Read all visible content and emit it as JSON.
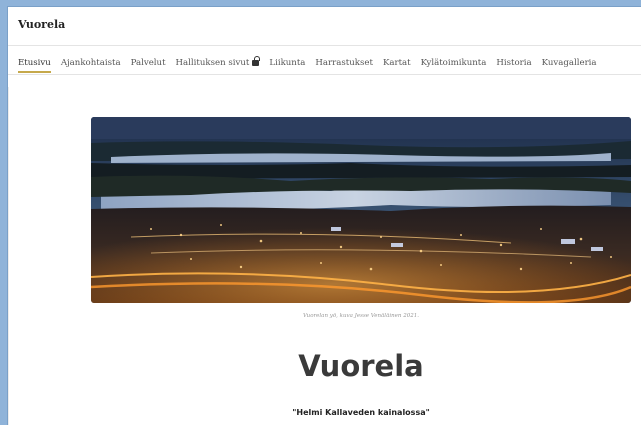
{
  "site": {
    "title": "Vuorela"
  },
  "nav": {
    "items": [
      {
        "label": "Etusivu",
        "active": true
      },
      {
        "label": "Ajankohtaista"
      },
      {
        "label": "Palvelut"
      },
      {
        "label": "Hallituksen sivut",
        "locked": true
      },
      {
        "label": "Liikunta"
      },
      {
        "label": "Harrastukset"
      },
      {
        "label": "Kartat"
      },
      {
        "label": "Kylätoimikunta"
      },
      {
        "label": "Historia"
      },
      {
        "label": "Kuvagalleria"
      }
    ],
    "lock_icon": "lock-icon",
    "accent_color": "#c6a94b"
  },
  "hero": {
    "caption": "Vuorelan yö, kuva Jesse Venäläinen 2021."
  },
  "page": {
    "heading": "Vuorela",
    "motto": "\"Helmi Kallaveden kainalossa\""
  },
  "colors": {
    "outer_background": "#8fb3d9",
    "page_background": "#ffffff"
  }
}
